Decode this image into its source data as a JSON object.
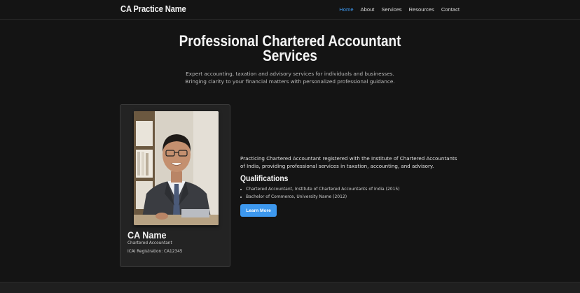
{
  "nav": {
    "brand": "CA Practice Name",
    "links": [
      "Home",
      "About",
      "Services",
      "Resources",
      "Contact"
    ],
    "active_index": 0
  },
  "hero": {
    "title": "Professional Chartered Accountant Services",
    "subtitle_line1": "Expert accounting, taxation and advisory services for individuals and businesses.",
    "subtitle_line2": "Bringing clarity to your financial matters with personalized professional guidance."
  },
  "profile": {
    "name": "CA Name",
    "role": "Chartered Accountant",
    "registration": "ICAI Registration: CA12345"
  },
  "about": {
    "intro": "Practicing Chartered Accountant registered with the Institute of Chartered Accountants of India, providing professional services in taxation, accounting, and advisory.",
    "qualifications_heading": "Qualifications",
    "qualifications": [
      "Chartered Accountant, Institute of Chartered Accountants of India (2015)",
      "Bachelor of Commerce, University Name (2012)"
    ],
    "button_label": "Learn More"
  },
  "colors": {
    "background": "#141414",
    "accent": "#3d98ee",
    "card": "#232323"
  }
}
